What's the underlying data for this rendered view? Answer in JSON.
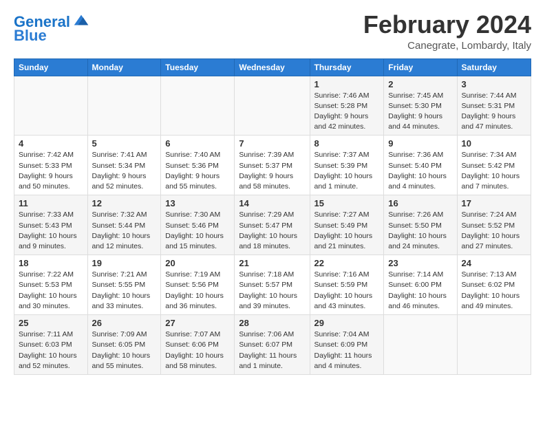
{
  "logo": {
    "line1": "General",
    "line2": "Blue"
  },
  "title": "February 2024",
  "subtitle": "Canegrate, Lombardy, Italy",
  "headers": [
    "Sunday",
    "Monday",
    "Tuesday",
    "Wednesday",
    "Thursday",
    "Friday",
    "Saturday"
  ],
  "weeks": [
    [
      {
        "day": "",
        "info": ""
      },
      {
        "day": "",
        "info": ""
      },
      {
        "day": "",
        "info": ""
      },
      {
        "day": "",
        "info": ""
      },
      {
        "day": "1",
        "info": "Sunrise: 7:46 AM\nSunset: 5:28 PM\nDaylight: 9 hours\nand 42 minutes."
      },
      {
        "day": "2",
        "info": "Sunrise: 7:45 AM\nSunset: 5:30 PM\nDaylight: 9 hours\nand 44 minutes."
      },
      {
        "day": "3",
        "info": "Sunrise: 7:44 AM\nSunset: 5:31 PM\nDaylight: 9 hours\nand 47 minutes."
      }
    ],
    [
      {
        "day": "4",
        "info": "Sunrise: 7:42 AM\nSunset: 5:33 PM\nDaylight: 9 hours\nand 50 minutes."
      },
      {
        "day": "5",
        "info": "Sunrise: 7:41 AM\nSunset: 5:34 PM\nDaylight: 9 hours\nand 52 minutes."
      },
      {
        "day": "6",
        "info": "Sunrise: 7:40 AM\nSunset: 5:36 PM\nDaylight: 9 hours\nand 55 minutes."
      },
      {
        "day": "7",
        "info": "Sunrise: 7:39 AM\nSunset: 5:37 PM\nDaylight: 9 hours\nand 58 minutes."
      },
      {
        "day": "8",
        "info": "Sunrise: 7:37 AM\nSunset: 5:39 PM\nDaylight: 10 hours\nand 1 minute."
      },
      {
        "day": "9",
        "info": "Sunrise: 7:36 AM\nSunset: 5:40 PM\nDaylight: 10 hours\nand 4 minutes."
      },
      {
        "day": "10",
        "info": "Sunrise: 7:34 AM\nSunset: 5:42 PM\nDaylight: 10 hours\nand 7 minutes."
      }
    ],
    [
      {
        "day": "11",
        "info": "Sunrise: 7:33 AM\nSunset: 5:43 PM\nDaylight: 10 hours\nand 9 minutes."
      },
      {
        "day": "12",
        "info": "Sunrise: 7:32 AM\nSunset: 5:44 PM\nDaylight: 10 hours\nand 12 minutes."
      },
      {
        "day": "13",
        "info": "Sunrise: 7:30 AM\nSunset: 5:46 PM\nDaylight: 10 hours\nand 15 minutes."
      },
      {
        "day": "14",
        "info": "Sunrise: 7:29 AM\nSunset: 5:47 PM\nDaylight: 10 hours\nand 18 minutes."
      },
      {
        "day": "15",
        "info": "Sunrise: 7:27 AM\nSunset: 5:49 PM\nDaylight: 10 hours\nand 21 minutes."
      },
      {
        "day": "16",
        "info": "Sunrise: 7:26 AM\nSunset: 5:50 PM\nDaylight: 10 hours\nand 24 minutes."
      },
      {
        "day": "17",
        "info": "Sunrise: 7:24 AM\nSunset: 5:52 PM\nDaylight: 10 hours\nand 27 minutes."
      }
    ],
    [
      {
        "day": "18",
        "info": "Sunrise: 7:22 AM\nSunset: 5:53 PM\nDaylight: 10 hours\nand 30 minutes."
      },
      {
        "day": "19",
        "info": "Sunrise: 7:21 AM\nSunset: 5:55 PM\nDaylight: 10 hours\nand 33 minutes."
      },
      {
        "day": "20",
        "info": "Sunrise: 7:19 AM\nSunset: 5:56 PM\nDaylight: 10 hours\nand 36 minutes."
      },
      {
        "day": "21",
        "info": "Sunrise: 7:18 AM\nSunset: 5:57 PM\nDaylight: 10 hours\nand 39 minutes."
      },
      {
        "day": "22",
        "info": "Sunrise: 7:16 AM\nSunset: 5:59 PM\nDaylight: 10 hours\nand 43 minutes."
      },
      {
        "day": "23",
        "info": "Sunrise: 7:14 AM\nSunset: 6:00 PM\nDaylight: 10 hours\nand 46 minutes."
      },
      {
        "day": "24",
        "info": "Sunrise: 7:13 AM\nSunset: 6:02 PM\nDaylight: 10 hours\nand 49 minutes."
      }
    ],
    [
      {
        "day": "25",
        "info": "Sunrise: 7:11 AM\nSunset: 6:03 PM\nDaylight: 10 hours\nand 52 minutes."
      },
      {
        "day": "26",
        "info": "Sunrise: 7:09 AM\nSunset: 6:05 PM\nDaylight: 10 hours\nand 55 minutes."
      },
      {
        "day": "27",
        "info": "Sunrise: 7:07 AM\nSunset: 6:06 PM\nDaylight: 10 hours\nand 58 minutes."
      },
      {
        "day": "28",
        "info": "Sunrise: 7:06 AM\nSunset: 6:07 PM\nDaylight: 11 hours\nand 1 minute."
      },
      {
        "day": "29",
        "info": "Sunrise: 7:04 AM\nSunset: 6:09 PM\nDaylight: 11 hours\nand 4 minutes."
      },
      {
        "day": "",
        "info": ""
      },
      {
        "day": "",
        "info": ""
      }
    ]
  ]
}
